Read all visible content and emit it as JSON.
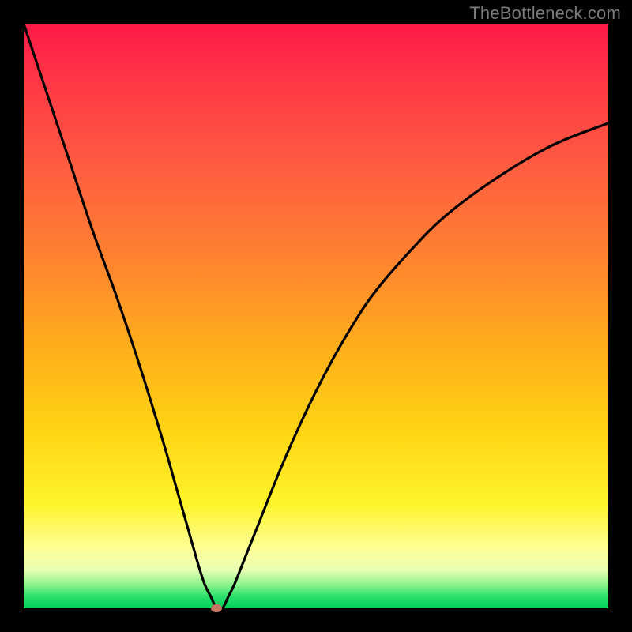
{
  "watermark": "TheBottleneck.com",
  "colors": {
    "frame": "#000000",
    "curve": "#000000",
    "marker": "#c77763",
    "gradient_stops": [
      "#ff1a48",
      "#ff3a46",
      "#ff5b41",
      "#ff8230",
      "#ffb01a",
      "#ffd514",
      "#fff42a",
      "#fdff99",
      "#e7ffb3",
      "#8bf28b",
      "#29e06a",
      "#00d15d"
    ]
  },
  "chart_data": {
    "type": "line",
    "title": "",
    "xlabel": "",
    "ylabel": "",
    "xlim": [
      0,
      100
    ],
    "ylim": [
      0,
      100
    ],
    "series": [
      {
        "name": "bottleneck-curve",
        "x": [
          0,
          4,
          8,
          12,
          16,
          20,
          24,
          26,
          28,
          30,
          31,
          32,
          33,
          34,
          35,
          36,
          38,
          40,
          44,
          48,
          52,
          56,
          60,
          66,
          72,
          80,
          90,
          100
        ],
        "y": [
          100,
          88,
          76,
          64,
          53,
          41,
          28,
          21,
          14,
          7,
          4,
          2,
          0,
          0,
          2,
          4,
          9,
          14,
          24,
          33,
          41,
          48,
          54,
          61,
          67,
          73,
          79,
          83
        ]
      }
    ],
    "markers": [
      {
        "name": "optimal-point",
        "x": 33,
        "y": 0
      }
    ],
    "background_scale": {
      "orientation": "vertical",
      "meaning": "bottleneck-severity",
      "low_color": "#00d15d",
      "high_color": "#ff1a48"
    }
  }
}
